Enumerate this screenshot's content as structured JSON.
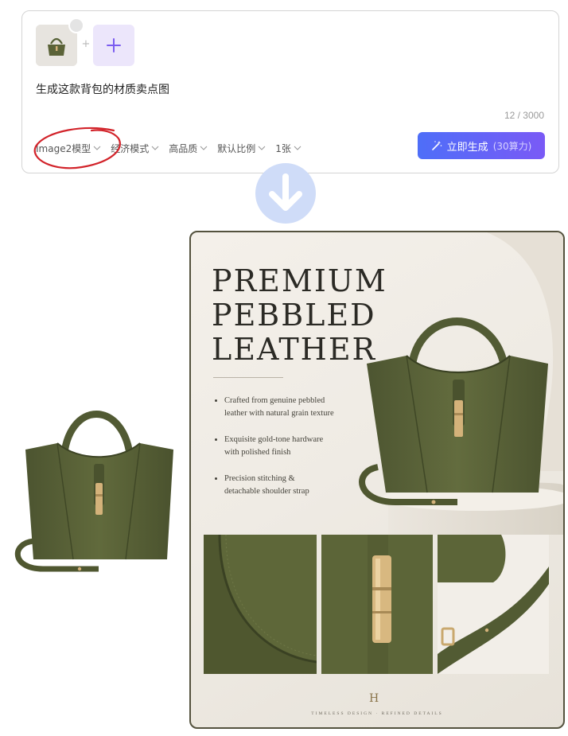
{
  "prompt_card": {
    "input_image_icon": "bag-thumbnail",
    "add_image_icon": "plus-icon",
    "prompt_text": "生成这款背包的材质卖点图",
    "char_count": "12 / 3000",
    "options": [
      {
        "label": "Image2模型"
      },
      {
        "label": "经济模式"
      },
      {
        "label": "高品质"
      },
      {
        "label": "默认比例"
      },
      {
        "label": "1张"
      }
    ],
    "generate_button": {
      "label": "立即生成",
      "cost": "(30算力)"
    },
    "colors": {
      "button_start": "#4e6ef8",
      "button_end": "#7a5af6",
      "annotation_circle": "#d2232a"
    }
  },
  "flow_arrow_icon": "arrow-down-circle-icon",
  "poster": {
    "headline": [
      "PREMIUM",
      "PEBBLED",
      "LEATHER"
    ],
    "features": [
      {
        "line1": "Crafted from genuine pebbled",
        "line2": "leather with natural grain texture"
      },
      {
        "line1": "Exquisite gold-tone hardware",
        "line2": "with polished finish"
      },
      {
        "line1": "Precision stitching &",
        "line2": "detachable shoulder strap"
      }
    ],
    "logo": "H",
    "tagline": "TIMELESS DESIGN · REFINED DETAILS",
    "colors": {
      "leather": "#5b6338",
      "hardware": "#d4b27a",
      "border": "#54523e"
    }
  }
}
